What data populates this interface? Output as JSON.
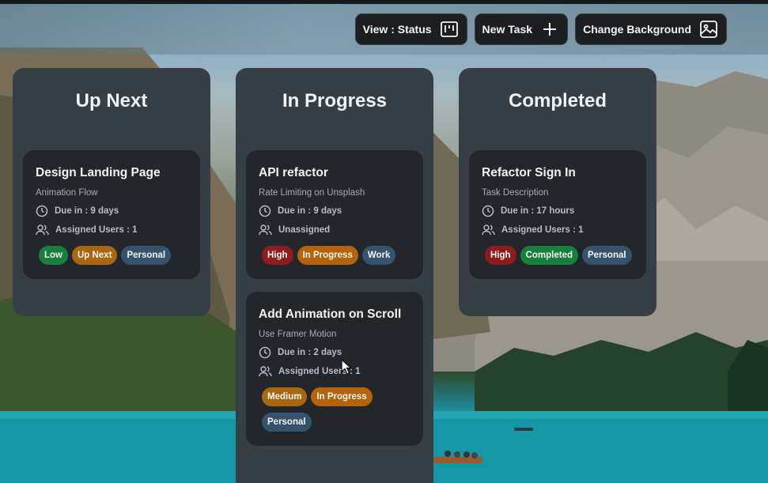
{
  "toolbar": {
    "view_label": "View : Status",
    "new_task_label": "New Task",
    "change_bg_label": "Change Background"
  },
  "columns": [
    {
      "title": "Up Next",
      "cards": [
        {
          "title": "Design Landing Page",
          "description": "Animation Flow",
          "due": "Due in : 9 days",
          "assigned": "Assigned Users : 1",
          "tags": [
            {
              "label": "Low",
              "color": "#16803c"
            },
            {
              "label": "Up Next",
              "color": "#a8670f"
            },
            {
              "label": "Personal",
              "color": "#36536e"
            }
          ]
        }
      ]
    },
    {
      "title": "In Progress",
      "cards": [
        {
          "title": "API refactor",
          "description": "Rate Limiting on Unsplash",
          "due": "Due in : 9 days",
          "assigned": "Unassigned",
          "tags": [
            {
              "label": "High",
              "color": "#8e1c1c"
            },
            {
              "label": "In Progress",
              "color": "#b5630a"
            },
            {
              "label": "Work",
              "color": "#36536e"
            }
          ]
        },
        {
          "title": "Add Animation on Scroll",
          "description": "Use Framer Motion",
          "due": "Due in : 2 days",
          "assigned": "Assigned Users : 1",
          "tags": [
            {
              "label": "Medium",
              "color": "#a8670f"
            },
            {
              "label": "In Progress",
              "color": "#b5630a"
            },
            {
              "label": "Personal",
              "color": "#36536e"
            }
          ]
        }
      ]
    },
    {
      "title": "Completed",
      "cards": [
        {
          "title": "Refactor Sign In",
          "description": "Task Description",
          "due": "Due in : 17 hours",
          "assigned": "Assigned Users : 1",
          "tags": [
            {
              "label": "High",
              "color": "#8e1c1c"
            },
            {
              "label": "Completed",
              "color": "#16803c"
            },
            {
              "label": "Personal",
              "color": "#36536e"
            }
          ]
        }
      ]
    }
  ]
}
